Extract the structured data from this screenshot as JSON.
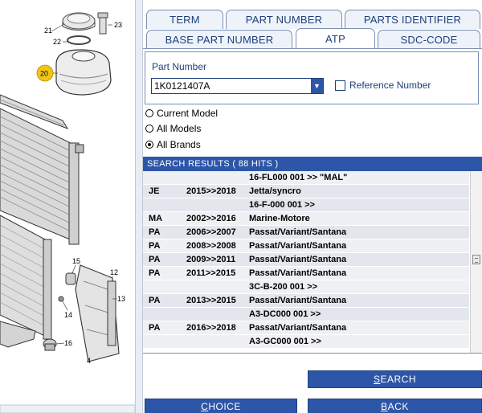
{
  "tabs": {
    "row1": [
      {
        "label": "TERM",
        "name": "tab-term"
      },
      {
        "label": "PART NUMBER",
        "name": "tab-part-number"
      },
      {
        "label": "PARTS IDENTIFIER",
        "name": "tab-parts-identifier"
      }
    ],
    "row2": [
      {
        "label": "BASE PART NUMBER",
        "name": "tab-base-part-number"
      },
      {
        "label": "ATP",
        "name": "tab-atp",
        "active": true
      },
      {
        "label": "SDC-CODE",
        "name": "tab-sdc-code"
      }
    ]
  },
  "part_number": {
    "label": "Part Number",
    "value": "1K0121407A",
    "reference_label": "Reference Number",
    "reference_checked": false
  },
  "scope": {
    "options": [
      "Current Model",
      "All Models",
      "All Brands"
    ],
    "selected": "All Brands"
  },
  "results": {
    "header": "SEARCH RESULTS  ( 88 HITS )",
    "rows": [
      {
        "code": "",
        "years": "",
        "model": "16-FL000 001 >> \"MAL\""
      },
      {
        "code": "JE",
        "years": "2015>>2018",
        "model": "Jetta/syncro"
      },
      {
        "code": "",
        "years": "",
        "model": "16-F-000 001 >>"
      },
      {
        "code": "MA",
        "years": "2002>>2016",
        "model": "Marine-Motore"
      },
      {
        "code": "PA",
        "years": "2006>>2007",
        "model": "Passat/Variant/Santana"
      },
      {
        "code": "PA",
        "years": "2008>>2008",
        "model": "Passat/Variant/Santana"
      },
      {
        "code": "PA",
        "years": "2009>>2011",
        "model": "Passat/Variant/Santana"
      },
      {
        "code": "PA",
        "years": "2011>>2015",
        "model": "Passat/Variant/Santana"
      },
      {
        "code": "",
        "years": "",
        "model": "3C-B-200 001 >>"
      },
      {
        "code": "PA",
        "years": "2013>>2015",
        "model": "Passat/Variant/Santana"
      },
      {
        "code": "",
        "years": "",
        "model": "A3-DC000 001 >>"
      },
      {
        "code": "PA",
        "years": "2016>>2018",
        "model": "Passat/Variant/Santana"
      },
      {
        "code": "",
        "years": "",
        "model": "A3-GC000 001 >>"
      }
    ]
  },
  "buttons": {
    "search": {
      "first": "S",
      "rest": "EARCH"
    },
    "choice": {
      "first": "C",
      "rest": "HOICE"
    },
    "back": {
      "first": "B",
      "rest": "ACK"
    }
  },
  "diagram": {
    "callouts": [
      "21",
      "23",
      "22",
      "20",
      "15",
      "12",
      "13",
      "14",
      "16",
      "4"
    ]
  },
  "colors": {
    "accent": "#2d56a8",
    "text_blue": "#1e3f7a",
    "callout_yellow": "#f0c419"
  }
}
